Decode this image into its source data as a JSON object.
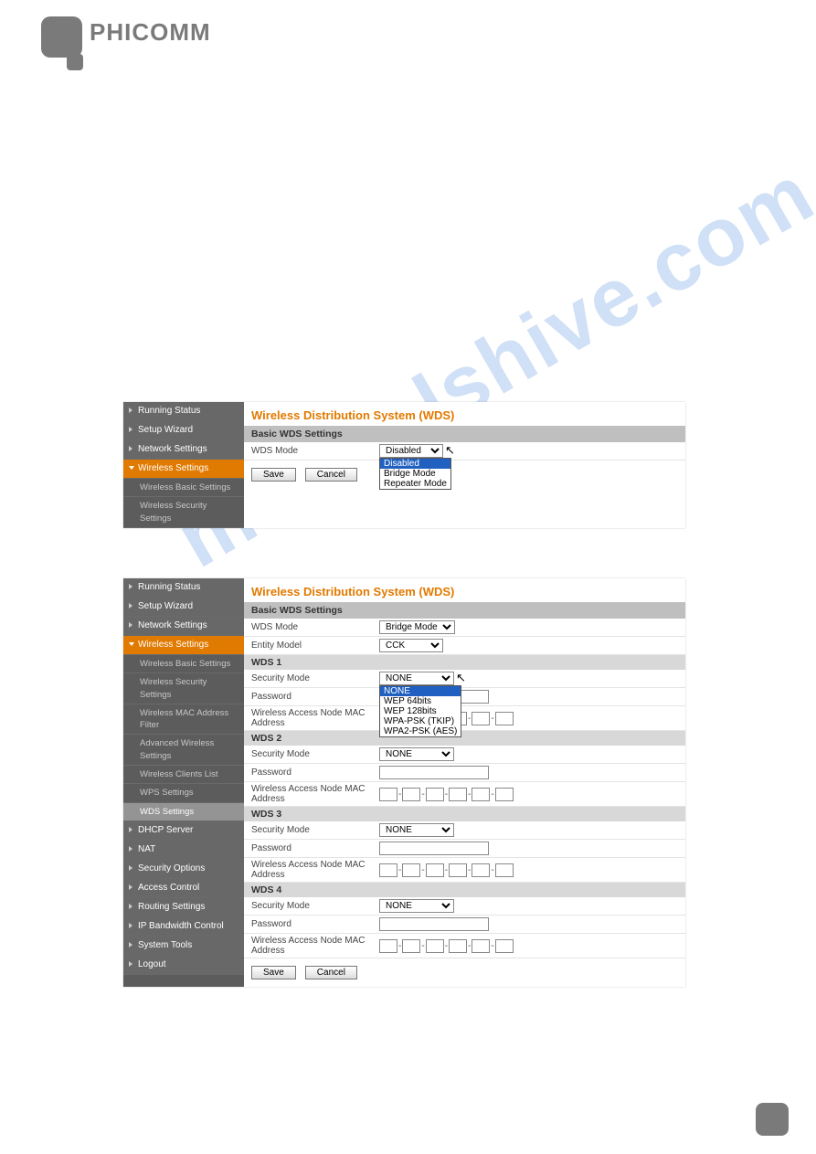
{
  "brand": "PHICOMM",
  "watermark": "manualshive.com",
  "panel1": {
    "title": "Wireless Distribution System (WDS)",
    "section_header": "Basic WDS Settings",
    "wds_mode_label": "WDS Mode",
    "wds_mode_value": "Disabled",
    "wds_mode_options": [
      "Disabled",
      "Bridge Mode",
      "Repeater Mode"
    ],
    "save": "Save",
    "cancel": "Cancel",
    "sidebar": [
      {
        "label": "Running Status",
        "type": "top"
      },
      {
        "label": "Setup Wizard",
        "type": "top"
      },
      {
        "label": "Network Settings",
        "type": "top"
      },
      {
        "label": "Wireless Settings",
        "type": "active"
      },
      {
        "label": "Wireless Basic Settings",
        "type": "sub"
      },
      {
        "label": "Wireless Security Settings",
        "type": "sub"
      }
    ]
  },
  "panel2": {
    "title": "Wireless Distribution System (WDS)",
    "section_header": "Basic WDS Settings",
    "wds_mode_label": "WDS Mode",
    "wds_mode_value": "Bridge Mode",
    "entity_model_label": "Entity Model",
    "entity_model_value": "CCK",
    "security_mode_label": "Security Mode",
    "password_label": "Password",
    "mac_label": "Wireless Access Node MAC Address",
    "sec_options": [
      "NONE",
      "WEP 64bits",
      "WEP 128bits",
      "WPA-PSK (TKIP)",
      "WPA2-PSK (AES)"
    ],
    "sec_value": "NONE",
    "wds_headers": [
      "WDS 1",
      "WDS 2",
      "WDS 3",
      "WDS 4"
    ],
    "save": "Save",
    "cancel": "Cancel",
    "sidebar": [
      {
        "label": "Running Status",
        "type": "top"
      },
      {
        "label": "Setup Wizard",
        "type": "top"
      },
      {
        "label": "Network Settings",
        "type": "top"
      },
      {
        "label": "Wireless Settings",
        "type": "active"
      },
      {
        "label": "Wireless Basic Settings",
        "type": "sub"
      },
      {
        "label": "Wireless Security Settings",
        "type": "sub"
      },
      {
        "label": "Wireless MAC Address Filter",
        "type": "sub"
      },
      {
        "label": "Advanced Wireless Settings",
        "type": "sub"
      },
      {
        "label": "Wireless Clients List",
        "type": "sub"
      },
      {
        "label": "WPS Settings",
        "type": "sub"
      },
      {
        "label": "WDS Settings",
        "type": "sub highlight"
      },
      {
        "label": "DHCP Server",
        "type": "top"
      },
      {
        "label": "NAT",
        "type": "top"
      },
      {
        "label": "Security Options",
        "type": "top"
      },
      {
        "label": "Access Control",
        "type": "top"
      },
      {
        "label": "Routing Settings",
        "type": "top"
      },
      {
        "label": "IP Bandwidth Control",
        "type": "top"
      },
      {
        "label": "System Tools",
        "type": "top"
      },
      {
        "label": "Logout",
        "type": "top"
      }
    ]
  }
}
